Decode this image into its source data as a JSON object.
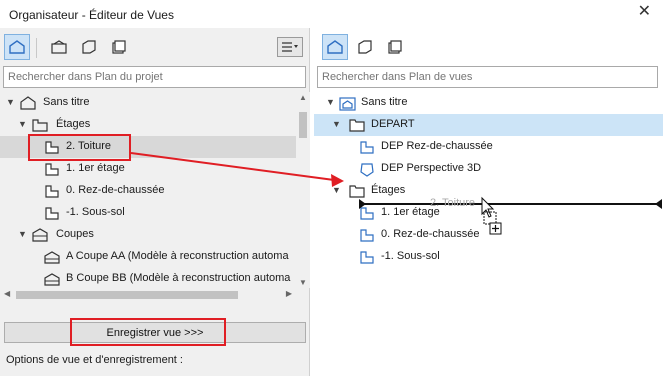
{
  "window": {
    "title": "Organisateur - Éditeur de Vues",
    "close_glyph": "✕"
  },
  "left": {
    "search_placeholder": "Rechercher dans Plan du projet",
    "tree": [
      {
        "label": "Sans titre",
        "icon": "project-house-icon",
        "arrow": "▼"
      },
      {
        "label": "Étages",
        "icon": "stories-folder-icon",
        "arrow": "▼"
      },
      {
        "label": "2. Toiture",
        "icon": "floor-plan-icon",
        "selected": true
      },
      {
        "label": "1. 1er étage",
        "icon": "floor-plan-icon"
      },
      {
        "label": "0. Rez-de-chaussée",
        "icon": "floor-plan-icon"
      },
      {
        "label": "-1. Sous-sol",
        "icon": "floor-plan-icon"
      },
      {
        "label": "Coupes",
        "icon": "sections-folder-icon",
        "arrow": "▼"
      },
      {
        "label": "A Coupe AA (Modèle à reconstruction automa",
        "icon": "section-icon"
      },
      {
        "label": "B Coupe BB (Modèle à reconstruction automa",
        "icon": "section-icon"
      }
    ],
    "save_label": "Enregistrer vue >>>",
    "options_label": "Options de vue et d'enregistrement :"
  },
  "right": {
    "search_placeholder": "Rechercher dans Plan de vues",
    "tree": [
      {
        "label": "Sans titre",
        "icon": "view-map-house-icon",
        "arrow": "▼"
      },
      {
        "label": "DEPART",
        "icon": "folder-icon",
        "arrow": "▼",
        "selected": true
      },
      {
        "label": "DEP Rez-de-chaussée",
        "icon": "floor-plan-view-icon"
      },
      {
        "label": "DEP Perspective 3D",
        "icon": "3d-view-icon"
      },
      {
        "label": "Étages",
        "icon": "folder-icon",
        "arrow": "▼"
      },
      {
        "label": "1. 1er étage",
        "icon": "floor-plan-view-icon"
      },
      {
        "label": "0. Rez-de-chaussée",
        "icon": "floor-plan-view-icon"
      },
      {
        "label": "-1. Sous-sol",
        "icon": "floor-plan-view-icon"
      }
    ],
    "drag_ghost_label": "2. Toiture"
  },
  "colors": {
    "highlight_red": "#e01e24",
    "selection_blue": "#cce4f7",
    "selection_gray": "#d8d8d8",
    "icon_blue": "#2f6fc2"
  }
}
